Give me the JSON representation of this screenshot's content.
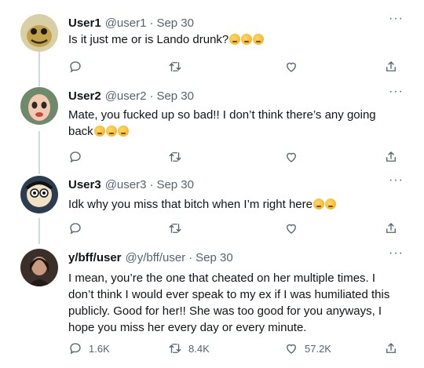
{
  "tweets": [
    {
      "name": "User1",
      "handle": "@user1",
      "date": "Sep 30",
      "text": "Is it just me or is Lando drunk?",
      "emoji_count": 3,
      "reply_count": "",
      "retweet_count": "",
      "like_count": ""
    },
    {
      "name": "User2",
      "handle": "@user2",
      "date": "Sep 30",
      "text": "Mate, you fucked up so bad!! I don’t think there’s any going back",
      "emoji_count": 3,
      "reply_count": "",
      "retweet_count": "",
      "like_count": ""
    },
    {
      "name": "User3",
      "handle": "@user3",
      "date": "Sep 30",
      "text": "Idk why you miss that bitch when I’m right here",
      "emoji_count": 2,
      "reply_count": "",
      "retweet_count": "",
      "like_count": ""
    },
    {
      "name": "y/bff/user",
      "handle": "@y/bff/user",
      "date": "Sep 30",
      "text": "I mean, you’re the one that cheated on her multiple times. I don’t think I would ever speak to my ex if I was humiliated this publicly. Good for her!! She was too good for you anyways, I hope you miss her every day or every minute.",
      "emoji_count": 0,
      "reply_count": "1.6K",
      "retweet_count": "8.4K",
      "like_count": "57.2K"
    }
  ],
  "separator": "·",
  "more_glyph": "···",
  "icons": {
    "reply": "reply-icon",
    "retweet": "retweet-icon",
    "like": "heart-icon",
    "share": "share-icon",
    "more": "more-icon"
  },
  "colors": {
    "text": "#0f1419",
    "secondary": "#536471",
    "thread_line": "#cfd9de"
  }
}
